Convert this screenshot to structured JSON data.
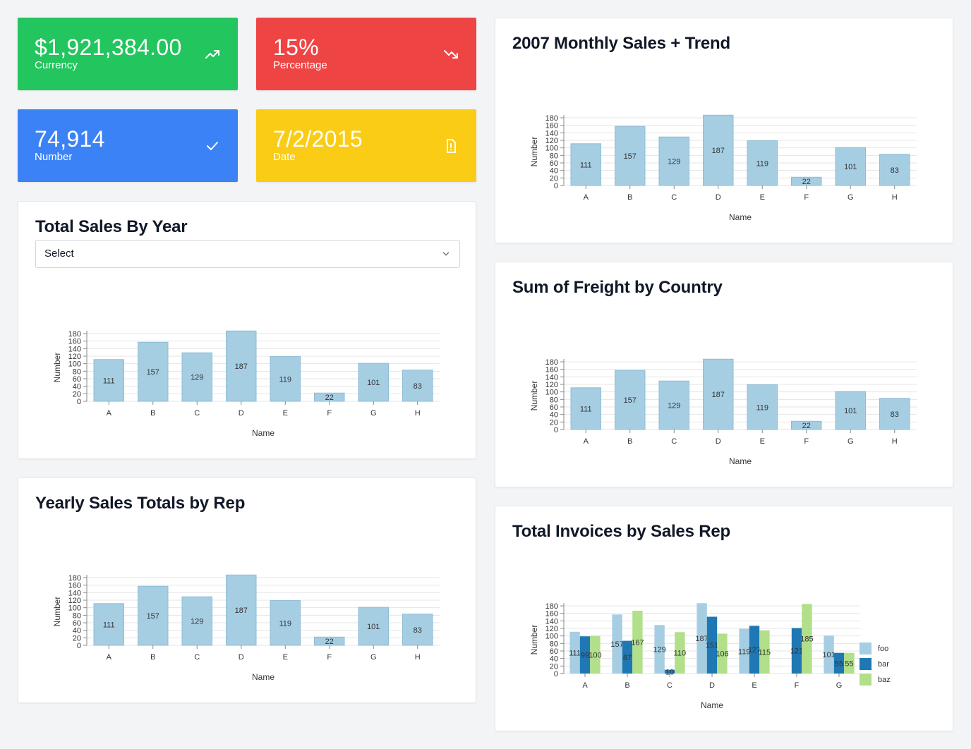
{
  "stats": [
    {
      "value": "$1,921,384.00",
      "label": "Currency",
      "color": "#22c55e",
      "icon": "trending-up-icon"
    },
    {
      "value": "15%",
      "label": "Percentage",
      "color": "#ef4444",
      "icon": "trending-down-icon"
    },
    {
      "value": "74,914",
      "label": "Number",
      "color": "#3b82f6",
      "icon": "check-icon"
    },
    {
      "value": "7/2/2015",
      "label": "Date",
      "color": "#facc15",
      "icon": "alert-document-icon"
    }
  ],
  "cards": {
    "total_sales": {
      "title": "Total Sales By Year",
      "select_value": "Select"
    },
    "yearly_rep": {
      "title": "Yearly Sales Totals by Rep"
    },
    "monthly": {
      "title": "2007 Monthly Sales + Trend"
    },
    "freight": {
      "title": "Sum of Freight by Country"
    },
    "invoices": {
      "title": "Total Invoices by Sales Rep"
    }
  },
  "chart_data": [
    {
      "id": "monthly",
      "type": "bar",
      "title": "2007 Monthly Sales + Trend",
      "xlabel": "Name",
      "ylabel": "Number",
      "categories": [
        "A",
        "B",
        "C",
        "D",
        "E",
        "F",
        "G",
        "H"
      ],
      "values": [
        111,
        157,
        129,
        187,
        119,
        22,
        101,
        83
      ],
      "ylim": [
        0,
        180
      ],
      "yticks": [
        0,
        20,
        40,
        60,
        80,
        100,
        120,
        140,
        160,
        180
      ],
      "grid": true,
      "color": "#a6cee3"
    },
    {
      "id": "total_sales",
      "type": "bar",
      "title": "Total Sales By Year",
      "xlabel": "Name",
      "ylabel": "Number",
      "categories": [
        "A",
        "B",
        "C",
        "D",
        "E",
        "F",
        "G",
        "H"
      ],
      "values": [
        111,
        157,
        129,
        187,
        119,
        22,
        101,
        83
      ],
      "ylim": [
        0,
        180
      ],
      "yticks": [
        0,
        20,
        40,
        60,
        80,
        100,
        120,
        140,
        160,
        180
      ],
      "grid": true,
      "color": "#a6cee3"
    },
    {
      "id": "freight",
      "type": "bar",
      "title": "Sum of Freight by Country",
      "xlabel": "Name",
      "ylabel": "Number",
      "categories": [
        "A",
        "B",
        "C",
        "D",
        "E",
        "F",
        "G",
        "H"
      ],
      "values": [
        111,
        157,
        129,
        187,
        119,
        22,
        101,
        83
      ],
      "ylim": [
        0,
        180
      ],
      "yticks": [
        0,
        20,
        40,
        60,
        80,
        100,
        120,
        140,
        160,
        180
      ],
      "grid": true,
      "color": "#a6cee3"
    },
    {
      "id": "yearly_rep",
      "type": "bar",
      "title": "Yearly Sales Totals by Rep",
      "xlabel": "Name",
      "ylabel": "Number",
      "categories": [
        "A",
        "B",
        "C",
        "D",
        "E",
        "F",
        "G",
        "H"
      ],
      "values": [
        111,
        157,
        129,
        187,
        119,
        22,
        101,
        83
      ],
      "ylim": [
        0,
        180
      ],
      "yticks": [
        0,
        20,
        40,
        60,
        80,
        100,
        120,
        140,
        160,
        180
      ],
      "grid": true,
      "color": "#a6cee3"
    },
    {
      "id": "invoices",
      "type": "bar",
      "title": "Total Invoices by Sales Rep",
      "xlabel": "Name",
      "ylabel": "Number",
      "categories": [
        "A",
        "B",
        "C",
        "D",
        "E",
        "F",
        "G"
      ],
      "series": [
        {
          "name": "foo",
          "color": "#a6cee3",
          "values": [
            111,
            157,
            129,
            187,
            119,
            null,
            101
          ]
        },
        {
          "name": "bar",
          "color": "#1f78b4",
          "values": [
            99,
            87,
            10,
            151,
            127,
            121,
            55
          ]
        },
        {
          "name": "baz",
          "color": "#b2df8a",
          "values": [
            100,
            167,
            110,
            106,
            115,
            185,
            55
          ]
        }
      ],
      "ylim": [
        0,
        180
      ],
      "yticks": [
        0,
        20,
        40,
        60,
        80,
        100,
        120,
        140,
        160,
        180
      ],
      "grid": true,
      "legend": "right"
    }
  ]
}
